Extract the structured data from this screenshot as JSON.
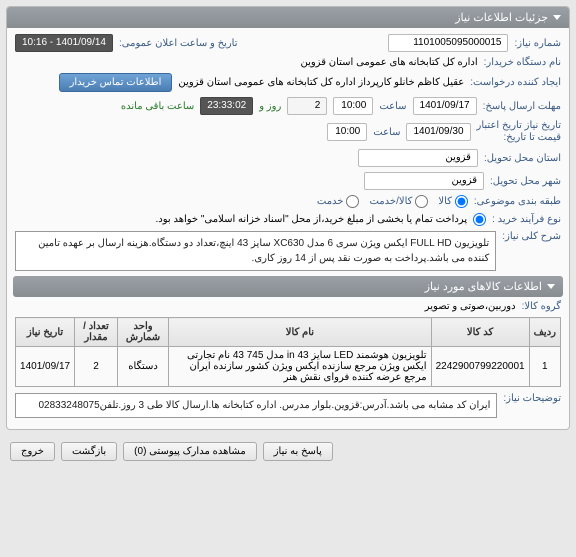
{
  "panel_title": "جزئیات اطلاعات نیاز",
  "fields": {
    "need_number_label": "شماره نیاز:",
    "need_number": "1101005095000015",
    "announce_label": "تاریخ و ساعت اعلان عمومی:",
    "announce": "1401/09/14 - 10:16",
    "device_label": "نام دستگاه خریدار:",
    "device": "اداره کل کتابخانه های عمومی استان قزوین",
    "requester_label": "ایجاد کننده درخواست:",
    "requester": "عقیل کاظم خانلو کارپرداز اداره کل کتابخانه های عمومی استان قزوین",
    "contact_btn": "اطلاعات تماس خریدار",
    "deadline_label": "مهلت ارسال پاسخ:",
    "deadline_date": "1401/09/17",
    "deadline_time_lbl": "ساعت",
    "deadline_time": "10:00",
    "countdown_1": "2",
    "countdown_day": "روز و",
    "countdown_2": "23:33:02",
    "countdown_tail": "ساعت باقی مانده",
    "credit_to_label": "تاریخ نیاز تاریخ اعتبار\nقیمت تا تاریخ:",
    "credit_date": "1401/09/30",
    "credit_time": "10:00",
    "province_label": "استان محل تحویل:",
    "province": "قزوین",
    "city_label": "شهر محل تحویل:",
    "city": "قزوین",
    "class_label": "طبقه بندی موضوعی:",
    "class_k": "کالا",
    "class_kh": "کالا/خدمت",
    "class_khd": "خدمت",
    "buy_type_label": "نوع فرآیند خرید :",
    "buy_type_note": "پرداخت تمام یا بخشی از مبلغ خرید،از محل \"اسناد خزانه اسلامی\" خواهد بود.",
    "desc_label": "شرح کلی نیاز:",
    "desc": "تلویزیون FULL HD ایکس ویژن سری 6 مدل XC630 سایز 43 اینچ،تعداد دو دستگاه.هزینه ارسال بر عهده تامین کننده می باشد.پرداخت به صورت نقد پس از 14 روز کاری."
  },
  "items": {
    "header": "اطلاعات کالاهای مورد نیاز",
    "group_label": "گروه کالا:",
    "group_val": "دوربین،صوتی و تصویر",
    "cols": {
      "idx": "ردیف",
      "code": "کد کالا",
      "name": "نام کالا",
      "unit": "واحد شمارش",
      "qty": "تعداد / مقدار",
      "date": "تاریخ نیاز"
    },
    "rows": [
      {
        "idx": "1",
        "code": "2242900799220001",
        "name": "تلویزیون هوشمند LED سایز 43 in مدل 745 43 نام تجارتی ایکس ویژن مرجع سازنده ایکس ویژن کشور سازنده ایران مرجع عرضه کننده فروای نقش هنر",
        "unit": "دستگاه",
        "qty": "2",
        "date": "1401/09/17"
      }
    ],
    "notes_label": "توضیحات نیاز:",
    "notes": "ایران کد مشابه می باشد.آدرس:قزوین.بلوار مدرس. اداره کتابخانه ها.ارسال کالا طی 3 روز.تلفن02833248075"
  },
  "footer": {
    "reply": "پاسخ به نیاز",
    "attachments": "مشاهده مدارک پیوستی (0)",
    "back": "بازگشت",
    "exit": "خروج"
  }
}
